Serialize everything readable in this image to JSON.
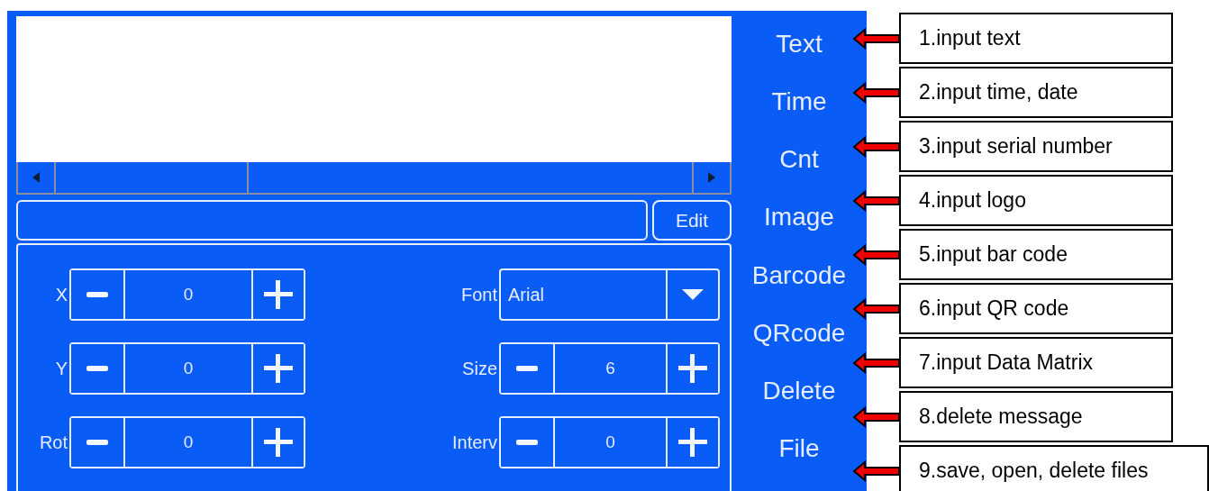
{
  "edit_button": "Edit",
  "left_params": [
    {
      "label": "X",
      "kind": "stepper",
      "value": "0"
    },
    {
      "label": "Y",
      "kind": "stepper",
      "value": "0"
    },
    {
      "label": "Rot",
      "kind": "stepper",
      "value": "0"
    }
  ],
  "right_params": [
    {
      "label": "Font",
      "kind": "dropdown",
      "value": "Arial"
    },
    {
      "label": "Size",
      "kind": "stepper",
      "value": "6"
    },
    {
      "label": "Interv",
      "kind": "stepper",
      "value": "0"
    }
  ],
  "menu": [
    "Text",
    "Time",
    "Cnt",
    "Image",
    "Barcode",
    "QRcode",
    "Delete",
    "File"
  ],
  "callouts": [
    "1.input text",
    "2.input time, date",
    "3.input serial number",
    "4.input logo",
    "5.input bar code",
    "6.input QR code",
    "7.input Data Matrix",
    "8.delete message",
    "9.save, open, delete files"
  ]
}
